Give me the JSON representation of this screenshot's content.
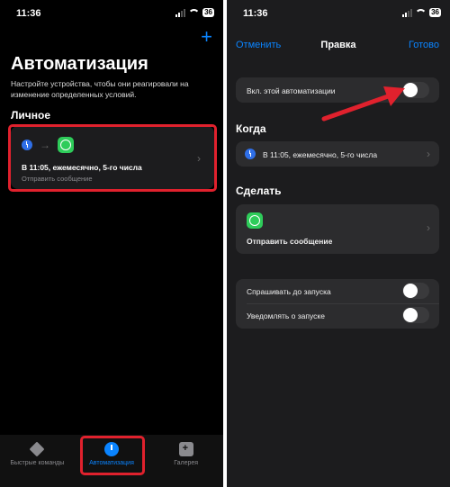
{
  "left": {
    "status": {
      "time": "11:36",
      "battery": "36"
    },
    "title": "Автоматизация",
    "subtitle": "Настройте устройства, чтобы они реагировали на изменение определенных условий.",
    "section": "Личное",
    "card": {
      "title": "В 11:05, ежемесячно, 5-го числа",
      "subtitle": "Отправить сообщение"
    },
    "tabs": [
      {
        "label": "Быстрые команды",
        "icon": "layers-icon"
      },
      {
        "label": "Автоматизация",
        "icon": "automation-icon"
      },
      {
        "label": "Галерея",
        "icon": "gallery-icon"
      }
    ]
  },
  "right": {
    "status": {
      "time": "11:36",
      "battery": "36"
    },
    "nav": {
      "cancel": "Отменить",
      "title": "Правка",
      "done": "Готово"
    },
    "enable_label": "Вкл. этой автоматизации",
    "when_header": "Когда",
    "when_value": "В 11:05, ежемесячно, 5-го числа",
    "do_header": "Сделать",
    "do_value": "Отправить сообщение",
    "ask_label": "Спрашивать до запуска",
    "notify_label": "Уведомлять о запуске"
  },
  "colors": {
    "accent": "#0a84ff",
    "highlight": "#e0212d",
    "whatsapp": "#2ecc5a"
  }
}
